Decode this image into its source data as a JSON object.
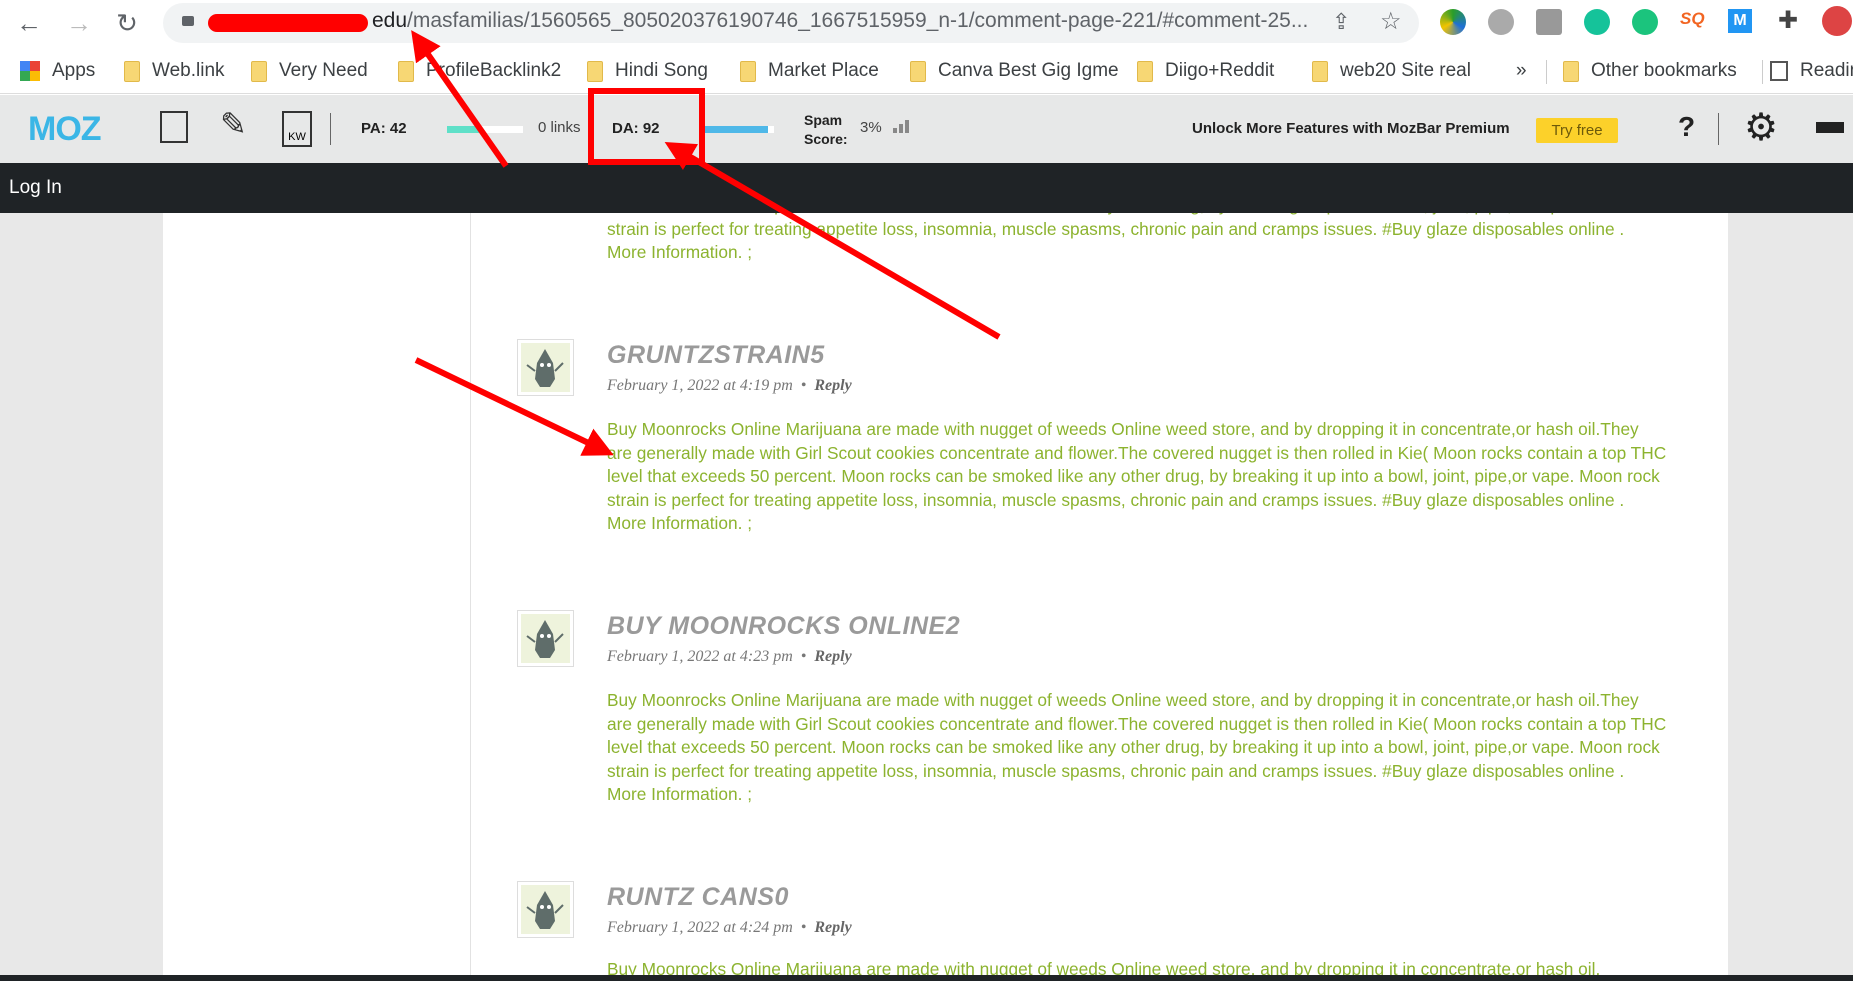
{
  "browser": {
    "url_domain_suffix": "edu",
    "url_path": "/masfamilias/1560565_805020376190746_1667515959_n-1/comment-page-221/#comment-25...",
    "bookmarks": [
      "Apps",
      "Web.link",
      "Very Need",
      "ProfileBacklink2",
      "Hindi Song",
      "Market Place",
      "Canva Best Gig Igme",
      "Diigo+Reddit",
      "web20 Site real"
    ],
    "more": "»",
    "other_bookmarks": "Other bookmarks",
    "reading_list": "Readin"
  },
  "mozbar": {
    "logo": "MOZ",
    "pa": "PA: 42",
    "pa_value": 42,
    "links": "0 links",
    "da": "DA: 92",
    "da_value": 92,
    "spam_label_1": "Spam",
    "spam_label_2": "Score:",
    "spam_value": "3%",
    "promo": "Unlock More Features with MozBar Premium",
    "try_free": "Try free",
    "help": "?"
  },
  "site": {
    "login": "Log In"
  },
  "comments": [
    {
      "name": "",
      "date": "",
      "reply": "",
      "text": "Buy Moonrocks Online Marijuana are made with nugget of weeds Online weed store, and by dropping it in concentrate,or hash oil.They are generally made with Girl Scout cookies concentrate and flower.The covered nugget is then rolled in Kie( Moon rocks contain a top THC level that exceeds 50 percent. Moon rocks can be smoked like any other drug, by breaking it up into a bowl, joint, pipe,or vape. Moon rock strain is perfect for treating appetite loss, insomnia, muscle spasms, chronic pain and cramps issues. #Buy glaze disposables online . More Information. ;"
    },
    {
      "name": "GRUNTZSTRAIN5",
      "date": "February 1, 2022 at 4:19 pm",
      "reply": "Reply",
      "text": "Buy Moonrocks Online Marijuana are made with nugget of weeds Online weed store, and by dropping it in concentrate,or hash oil.They are generally made with Girl Scout cookies concentrate and flower.The covered nugget is then rolled in Kie( Moon rocks contain a top THC level that exceeds 50 percent. Moon rocks can be smoked like any other drug, by breaking it up into a bowl, joint, pipe,or vape. Moon rock strain is perfect for treating appetite loss, insomnia, muscle spasms, chronic pain and cramps issues. #Buy glaze disposables online . More Information. ;"
    },
    {
      "name": "BUY MOONROCKS ONLINE2",
      "date": "February 1, 2022 at 4:23 pm",
      "reply": "Reply",
      "text": "Buy Moonrocks Online Marijuana are made with nugget of weeds Online weed store, and by dropping it in concentrate,or hash oil.They are generally made with Girl Scout cookies concentrate and flower.The covered nugget is then rolled in Kie( Moon rocks contain a top THC level that exceeds 50 percent. Moon rocks can be smoked like any other drug, by breaking it up into a bowl, joint, pipe,or vape. Moon rock strain is perfect for treating appetite loss, insomnia, muscle spasms, chronic pain and cramps issues. #Buy glaze disposables online . More Information. ;"
    },
    {
      "name": "RUNTZ CANS0",
      "date": "February 1, 2022 at 4:24 pm",
      "reply": "Reply",
      "text": "Buy Moonrocks Online Marijuana are made with nugget of weeds Online weed store, and by dropping it in concentrate,or hash oil."
    }
  ],
  "colors": {
    "moz_blue": "#3bb6e6",
    "pa_bar": "#5fe0c8",
    "da_bar": "#4fb8e8",
    "try_free": "#fcd12a",
    "comment_text": "#8cb32f",
    "annotation": "#ff0000"
  }
}
